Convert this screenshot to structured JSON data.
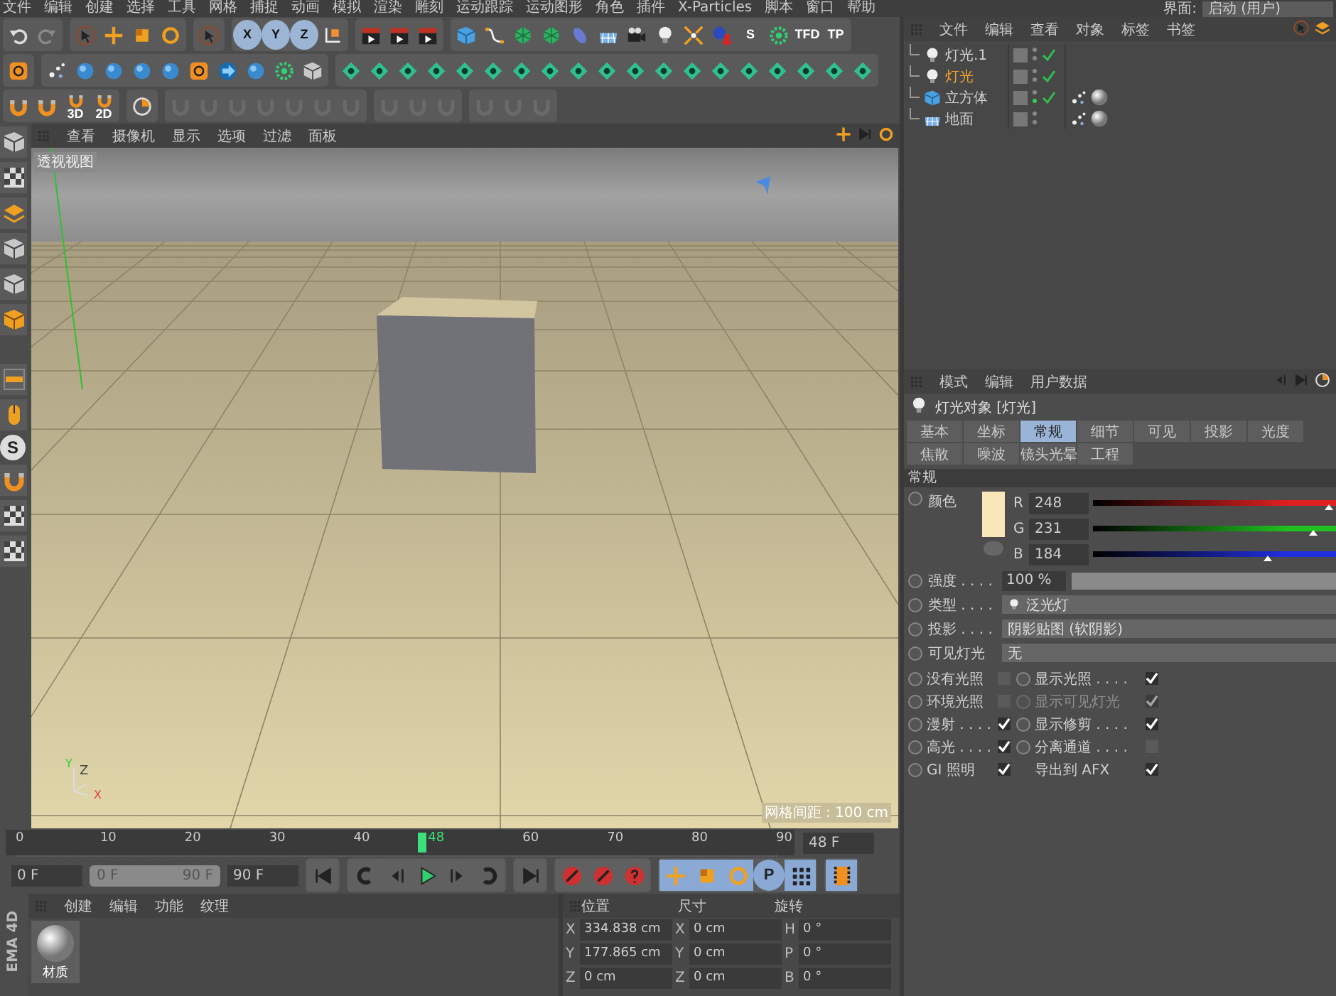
{
  "menu_bar": {
    "items": [
      "文件",
      "编辑",
      "创建",
      "选择",
      "工具",
      "网格",
      "捕捉",
      "动画",
      "模拟",
      "渲染",
      "雕刻",
      "运动跟踪",
      "运动图形",
      "角色",
      "插件",
      "X-Particles",
      "脚本",
      "窗口",
      "帮助"
    ],
    "layout_label": "界面:",
    "layout_value": "启动 (用户)"
  },
  "toolbar": {
    "labels": [
      {
        "text": "X",
        "active": true
      },
      {
        "text": "Y",
        "active": true
      },
      {
        "text": "Z",
        "active": true
      },
      {
        "text": "S",
        "active": false
      },
      {
        "text": "TFD",
        "active": false
      },
      {
        "text": "TP",
        "active": false
      },
      {
        "text": "3D",
        "active": false
      },
      {
        "text": "2D",
        "active": false
      },
      {
        "text": "S",
        "active": false
      },
      {
        "text": "P",
        "active": true
      }
    ]
  },
  "viewport": {
    "menu": [
      "查看",
      "摄像机",
      "显示",
      "选项",
      "过滤",
      "面板"
    ],
    "view_name": "透视视图",
    "grid_spacing": "网格间距 : 100 cm",
    "axes": [
      "Z",
      "Y",
      "X"
    ]
  },
  "timeline": {
    "ticks": [
      "0",
      "10",
      "20",
      "30",
      "40",
      "60",
      "70",
      "80",
      "90"
    ],
    "current": "48",
    "level": 0.533,
    "frame_field": "48 F",
    "start": "0 F",
    "range": {
      "start": "0 F",
      "end": "90 F",
      "level": 1
    },
    "end": "90 F"
  },
  "materials": {
    "menu": [
      "创建",
      "编辑",
      "功能",
      "纹理"
    ],
    "items": [
      {
        "name": "材质"
      }
    ]
  },
  "coordinates": {
    "headers": [
      "位置",
      "尺寸",
      "旋转"
    ],
    "rows": [
      {
        "cells": [
          {
            "axis": "X",
            "value": "334.838 cm"
          },
          {
            "axis": "X",
            "value": "0 cm"
          },
          {
            "axis": "H",
            "value": "0 °"
          }
        ]
      },
      {
        "cells": [
          {
            "axis": "Y",
            "value": "177.865 cm"
          },
          {
            "axis": "Y",
            "value": "0 cm"
          },
          {
            "axis": "P",
            "value": "0 °"
          }
        ]
      },
      {
        "cells": [
          {
            "axis": "Z",
            "value": "0 cm"
          },
          {
            "axis": "Z",
            "value": "0 cm"
          },
          {
            "axis": "B",
            "value": "0 °"
          }
        ]
      }
    ]
  },
  "branding": [
    "EMA 4D"
  ],
  "object_manager": {
    "menu": [
      "文件",
      "编辑",
      "查看",
      "对象",
      "标签",
      "书签"
    ],
    "objects": [
      {
        "name": "灯光.1",
        "kind": "light",
        "selected": false,
        "enabled": true,
        "has_material": false
      },
      {
        "name": "灯光",
        "kind": "light",
        "selected": true,
        "enabled": true,
        "has_material": false
      },
      {
        "name": "立方体",
        "kind": "cube",
        "selected": false,
        "enabled": true,
        "has_material": true
      },
      {
        "name": "地面",
        "kind": "floor",
        "selected": false,
        "enabled": false,
        "has_material": true
      }
    ]
  },
  "attributes": {
    "menu": [
      "模式",
      "编辑",
      "用户数据"
    ],
    "title": "灯光对象 [灯光]",
    "tabs": [
      {
        "label": "基本",
        "selected": false
      },
      {
        "label": "坐标",
        "selected": false
      },
      {
        "label": "常规",
        "selected": true
      },
      {
        "label": "细节",
        "selected": false
      },
      {
        "label": "可见",
        "selected": false
      },
      {
        "label": "投影",
        "selected": false
      },
      {
        "label": "光度",
        "selected": false
      },
      {
        "label": "焦散",
        "selected": false
      },
      {
        "label": "噪波",
        "selected": false
      },
      {
        "label": "镜头光晕",
        "selected": false
      },
      {
        "label": "工程",
        "selected": false
      }
    ],
    "section": "常规",
    "color": {
      "label": "颜色",
      "color": "#f8e7b8",
      "channels": [
        {
          "name": "R",
          "value": "248",
          "level": 0.973,
          "color": "#e02020"
        },
        {
          "name": "G",
          "value": "231",
          "level": 0.906,
          "color": "#20c020"
        },
        {
          "name": "B",
          "value": "184",
          "level": 0.722,
          "color": "#2030e0"
        }
      ]
    },
    "fields": [
      {
        "kind": "number",
        "label": "强度 . . . .",
        "value": "100 %",
        "level": 1
      },
      {
        "kind": "dropdown",
        "label": "类型 . . . .",
        "value": "泛光灯",
        "icon": true
      },
      {
        "kind": "dropdown",
        "label": "投影 . . . .",
        "value": "阴影贴图 (软阴影)",
        "icon": false
      },
      {
        "kind": "dropdown",
        "label": "可见灯光",
        "value": "无",
        "icon": false
      }
    ],
    "checks": [
      {
        "label": "没有光照",
        "checked": false,
        "disabled": false,
        "keyframe": true
      },
      {
        "label": "显示光照 . . . .",
        "checked": true,
        "disabled": false,
        "keyframe": true
      },
      {
        "label": "环境光照",
        "checked": false,
        "disabled": false,
        "keyframe": true
      },
      {
        "label": "显示可见灯光",
        "checked": true,
        "disabled": true,
        "keyframe": true
      },
      {
        "label": "漫射 . . . .",
        "checked": true,
        "disabled": false,
        "keyframe": true
      },
      {
        "label": "显示修剪 . . . .",
        "checked": true,
        "disabled": false,
        "keyframe": true
      },
      {
        "label": "高光 . . . .",
        "checked": true,
        "disabled": false,
        "keyframe": true
      },
      {
        "label": "分离通道 . . . .",
        "checked": false,
        "disabled": false,
        "keyframe": true
      },
      {
        "label": "GI 照明",
        "checked": true,
        "disabled": false,
        "keyframe": true
      },
      {
        "label": "导出到 AFX",
        "checked": true,
        "disabled": false,
        "keyframe": false
      }
    ]
  }
}
